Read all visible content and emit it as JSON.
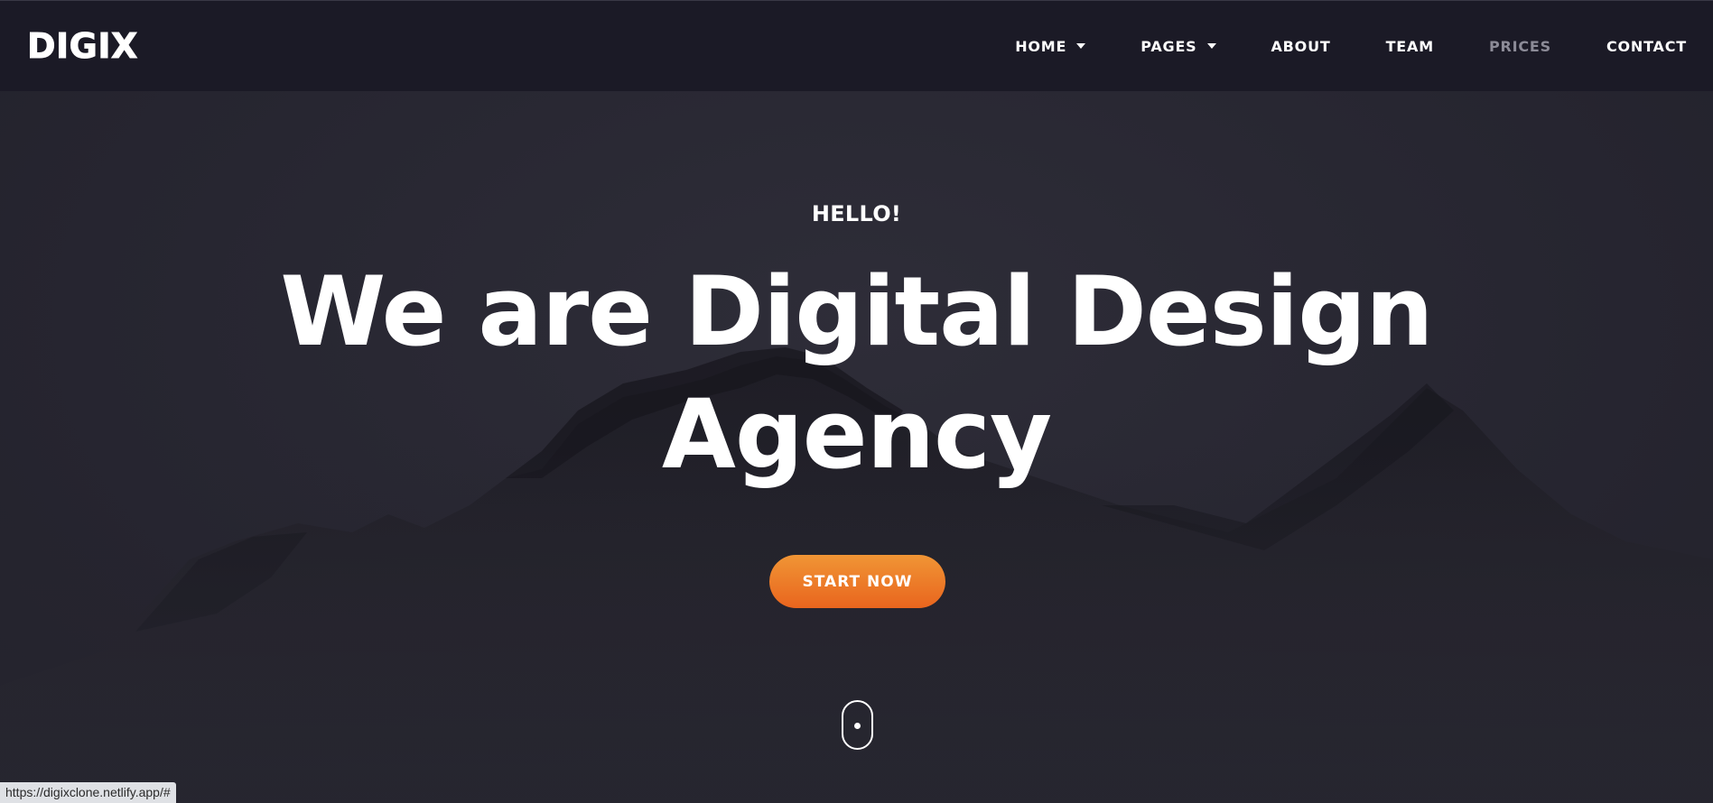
{
  "brand": {
    "logo_text": "DIGIX"
  },
  "nav": {
    "items": [
      {
        "label": "HOME",
        "has_dropdown": true
      },
      {
        "label": "PAGES",
        "has_dropdown": true
      },
      {
        "label": "ABOUT",
        "has_dropdown": false
      },
      {
        "label": "TEAM",
        "has_dropdown": false
      },
      {
        "label": "PRICES",
        "has_dropdown": false
      },
      {
        "label": "CONTACT",
        "has_dropdown": false
      }
    ]
  },
  "hero": {
    "eyebrow": "HELLO!",
    "headline": "We are Digital Design Agency",
    "cta_label": "START NOW",
    "background": "mountain-silhouette"
  },
  "status_bar": {
    "url": "https://digixclone.netlify.app/#"
  },
  "colors": {
    "navbar_bg": "#1b1a26",
    "hero_bg": "#26252f",
    "accent_gradient_top": "#f09535",
    "accent_gradient_bottom": "#e9651e",
    "nav_muted": "#8c8b97"
  },
  "icons": {
    "dropdown": "chevron-down-icon",
    "scroll": "mouse-scroll-icon"
  }
}
